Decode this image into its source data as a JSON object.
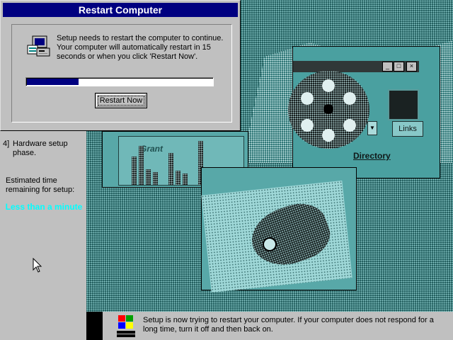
{
  "dialog": {
    "title": "Restart Computer",
    "message": "Setup needs to restart the computer to continue. Your computer will automatically restart in 15 seconds or when you click 'Restart Now'.",
    "progress_fraction": 0.28,
    "restart_button_label": "Restart Now",
    "icon": "computer-setup-icon"
  },
  "sidebar": {
    "step_number": "4]",
    "step_label": "Hardware setup phase.",
    "eta_label": "Estimated time remaining for setup:",
    "eta_value": "Less than a minute"
  },
  "background_art": {
    "chart_window_caption": "Grant",
    "links_button": "Links",
    "directory_label": "Directory"
  },
  "status_bar": {
    "logo": "windows-logo",
    "message": "Setup is now trying to restart your computer. If your computer does not respond for a long time, turn it off and then back on."
  },
  "colors": {
    "title_bar": "#000080",
    "eta_text": "#00ffff",
    "face": "#c0c0c0",
    "art_teal": "#1e5a5a"
  }
}
